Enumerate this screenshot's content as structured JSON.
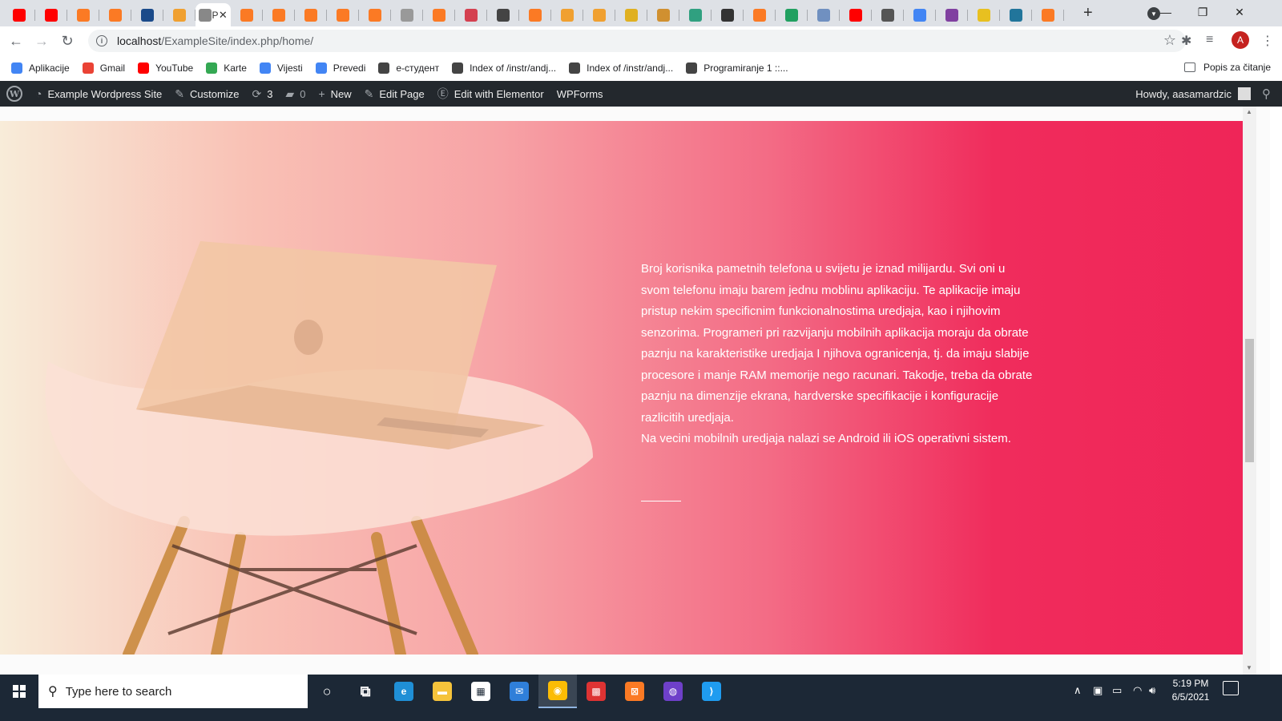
{
  "browser": {
    "tabs": [
      {
        "icon": "youtube-icon",
        "color": "#ff0000"
      },
      {
        "icon": "youtube-icon",
        "color": "#ff0000"
      },
      {
        "icon": "xampp-icon",
        "color": "#fb7a24"
      },
      {
        "icon": "xampp-icon",
        "color": "#fb7a24"
      },
      {
        "icon": "shield-icon",
        "color": "#1a4a8a"
      },
      {
        "icon": "pma-icon",
        "color": "#f0a030"
      },
      {
        "icon": "page-icon",
        "color": "#888888",
        "active": true,
        "title": "P"
      },
      {
        "icon": "xampp-icon",
        "color": "#fb7a24"
      },
      {
        "icon": "xampp-icon",
        "color": "#fb7a24"
      },
      {
        "icon": "xampp-icon",
        "color": "#fb7a24"
      },
      {
        "icon": "xampp-icon",
        "color": "#fb7a24"
      },
      {
        "icon": "xampp-icon",
        "color": "#fb7a24"
      },
      {
        "icon": "xampp-icon",
        "color": "#999999"
      },
      {
        "icon": "xampp-icon",
        "color": "#fb7a24"
      },
      {
        "icon": "dribbble-icon",
        "color": "#d44050"
      },
      {
        "icon": "mountain-icon",
        "color": "#444444"
      },
      {
        "icon": "xampp-icon",
        "color": "#fb7a24"
      },
      {
        "icon": "pma-icon",
        "color": "#f0a030"
      },
      {
        "icon": "pma-icon",
        "color": "#f0a030"
      },
      {
        "icon": "image-icon",
        "color": "#e0b020"
      },
      {
        "icon": "puzzle-icon",
        "color": "#d09030"
      },
      {
        "icon": "d-icon",
        "color": "#30a080"
      },
      {
        "icon": "wikipedia-icon",
        "color": "#333333"
      },
      {
        "icon": "xampp-icon",
        "color": "#fb7a24"
      },
      {
        "icon": "play-icon",
        "color": "#20a060"
      },
      {
        "icon": "people-icon",
        "color": "#7090c0"
      },
      {
        "icon": "youtube-icon",
        "color": "#ff0000"
      },
      {
        "icon": "globe-icon",
        "color": "#555555"
      },
      {
        "icon": "google-icon",
        "color": "#4285f4"
      },
      {
        "icon": "circle-icon",
        "color": "#8040a0"
      },
      {
        "icon": "emoji-icon",
        "color": "#e8c020"
      },
      {
        "icon": "wordpress-icon",
        "color": "#21759b"
      },
      {
        "icon": "xampp-icon",
        "color": "#fb7a24"
      }
    ],
    "active_tab_title": "P",
    "new_tab": "+",
    "url_host": "localhost",
    "url_path": "/ExampleSite/index.php/home/",
    "profile_initial": "A"
  },
  "bookmarks": {
    "items": [
      {
        "label": "Aplikacije",
        "icon": "apps-grid-icon",
        "color": "#4285f4"
      },
      {
        "label": "Gmail",
        "icon": "gmail-icon",
        "color": "#ea4335"
      },
      {
        "label": "YouTube",
        "icon": "youtube-icon",
        "color": "#ff0000"
      },
      {
        "label": "Karte",
        "icon": "maps-icon",
        "color": "#34a853"
      },
      {
        "label": "Vijesti",
        "icon": "news-icon",
        "color": "#4285f4"
      },
      {
        "label": "Prevedi",
        "icon": "translate-icon",
        "color": "#4285f4"
      },
      {
        "label": "е-студент",
        "icon": "globe-icon",
        "color": "#444444"
      },
      {
        "label": "Index of /instr/andj...",
        "icon": "globe-icon",
        "color": "#444444"
      },
      {
        "label": "Index of /instr/andj...",
        "icon": "globe-icon",
        "color": "#444444"
      },
      {
        "label": "Programiranje 1 ::...",
        "icon": "globe-icon",
        "color": "#444444"
      }
    ],
    "reading_list": "Popis za čitanje"
  },
  "adminbar": {
    "site_name": "Example Wordpress Site",
    "customize": "Customize",
    "updates_count": "3",
    "comments_count": "0",
    "new": "New",
    "edit_page": "Edit Page",
    "edit_elementor": "Edit with Elementor",
    "wpforms": "WPForms",
    "howdy": "Howdy, aasamardzic"
  },
  "hero": {
    "paragraph": "Broj korisnika pametnih telefona u svijetu je iznad milijardu. Svi oni u svom telefonu imaju barem jednu moblinu aplikaciju. Te aplikacije imaju pristup nekim specificnim funkcionalnostima uredjaja, kao i njihovim senzorima. Programeri pri razvijanju mobilnih aplikacija moraju da obrate paznju na karakteristike uredjaja I njihova ogranicenja, tj. da imaju slabije procesore i manje RAM memorije nego racunari. Takodje, treba da obrate paznju na dimenzije ekrana, hardverske specifikacije i konfiguracije razlicitih uredjaja.",
    "paragraph2": "Na vecini mobilnih uredjaja nalazi se Android ili iOS operativni sistem.",
    "gradient_start": "#f8ecd9",
    "gradient_end": "#ef2558"
  },
  "taskbar": {
    "search_placeholder": "Type here to search",
    "time": "5:19 PM",
    "date": "6/5/2021",
    "apps": [
      {
        "name": "cortana-icon",
        "color": "#1c2836"
      },
      {
        "name": "task-view-icon",
        "color": "#1c2836"
      },
      {
        "name": "edge-icon",
        "color": "#1f8fd6"
      },
      {
        "name": "file-explorer-icon",
        "color": "#f5c33b"
      },
      {
        "name": "store-icon",
        "color": "#ffffff"
      },
      {
        "name": "mail-icon",
        "color": "#2f7fd9"
      },
      {
        "name": "chrome-icon",
        "color": "#fbbc05"
      },
      {
        "name": "color-app-icon",
        "color": "#d33"
      },
      {
        "name": "xampp-icon",
        "color": "#fb7a24"
      },
      {
        "name": "github-icon",
        "color": "#6e40c9"
      },
      {
        "name": "vscode-icon",
        "color": "#1f9cf0"
      }
    ]
  }
}
